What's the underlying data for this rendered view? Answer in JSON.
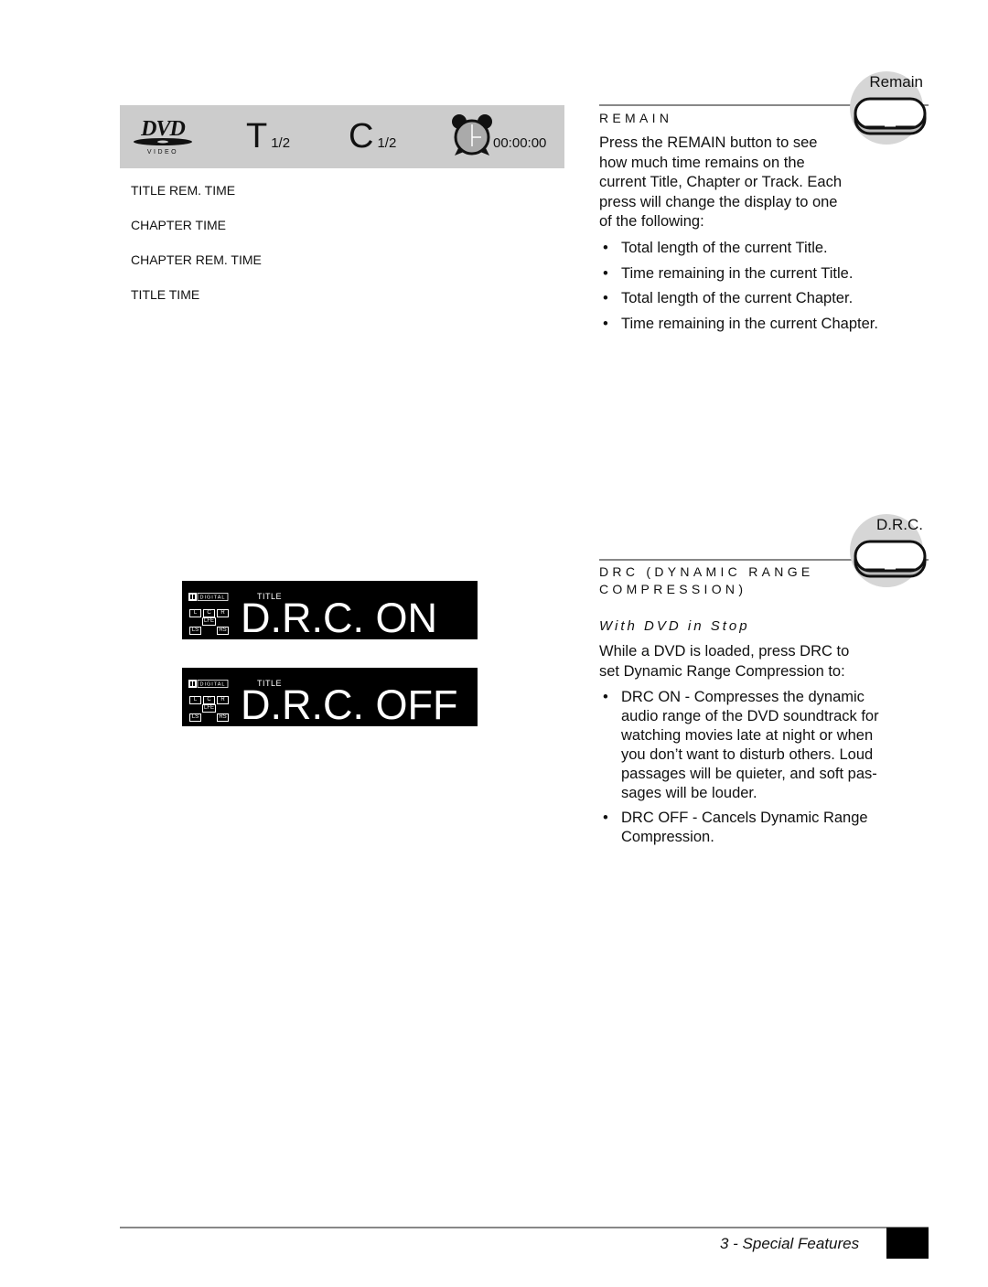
{
  "osd": {
    "logo": "dvd-video-logo",
    "title_letter": "T",
    "title_fraction": "1/2",
    "chapter_letter": "C",
    "chapter_fraction": "1/2",
    "clock_icon": "alarm-clock-icon",
    "time": "00:00:00"
  },
  "display_modes": [
    "TITLE REM. TIME",
    "CHAPTER TIME",
    "CHAPTER REM. TIME",
    "TITLE TIME"
  ],
  "remain_section": {
    "button_label": "Remain",
    "heading": "REMAIN",
    "body_lines": [
      "Press the REMAIN button to see",
      "how much time remains on the",
      "current Title, Chapter or Track. Each",
      "press will change the display to one",
      "of the following:"
    ],
    "bullets": [
      "Total length of the current Title.",
      "Time remaining in the current Title.",
      "Total length of the current Chapter.",
      "Time remaining in the current Chapter."
    ]
  },
  "drc_section": {
    "button_label": "D.R.C.",
    "heading_line1": "DRC (DYNAMIC RANGE",
    "heading_line2": "COMPRESSION)",
    "subheading": "With DVD in Stop",
    "body_lines": [
      "While a DVD is loaded, press DRC to",
      "set Dynamic Range Compression to:"
    ],
    "bullets": [
      {
        "lines": [
          "DRC ON - Compresses the dynamic",
          "audio range of the DVD soundtrack for",
          "watching movies late at night or when",
          "you don’t want to disturb others. Loud",
          "passages will be quieter, and soft pas-",
          "sages will be louder."
        ]
      },
      {
        "lines": [
          "DRC OFF - Cancels Dynamic Range",
          "Compression."
        ]
      }
    ]
  },
  "lcd_panels": [
    {
      "digital": "DIGITAL",
      "title": "TITLE",
      "channels": [
        "L",
        "C",
        "R",
        "LFE",
        "LS",
        "RS"
      ],
      "text": "D.R.C. ON"
    },
    {
      "digital": "DIGITAL",
      "title": "TITLE",
      "channels": [
        "L",
        "C",
        "R",
        "LFE",
        "LS",
        "RS"
      ],
      "text": "D.R.C. OFF"
    }
  ],
  "footer": {
    "section": "3 - Special Features"
  },
  "bullet_char": "•"
}
